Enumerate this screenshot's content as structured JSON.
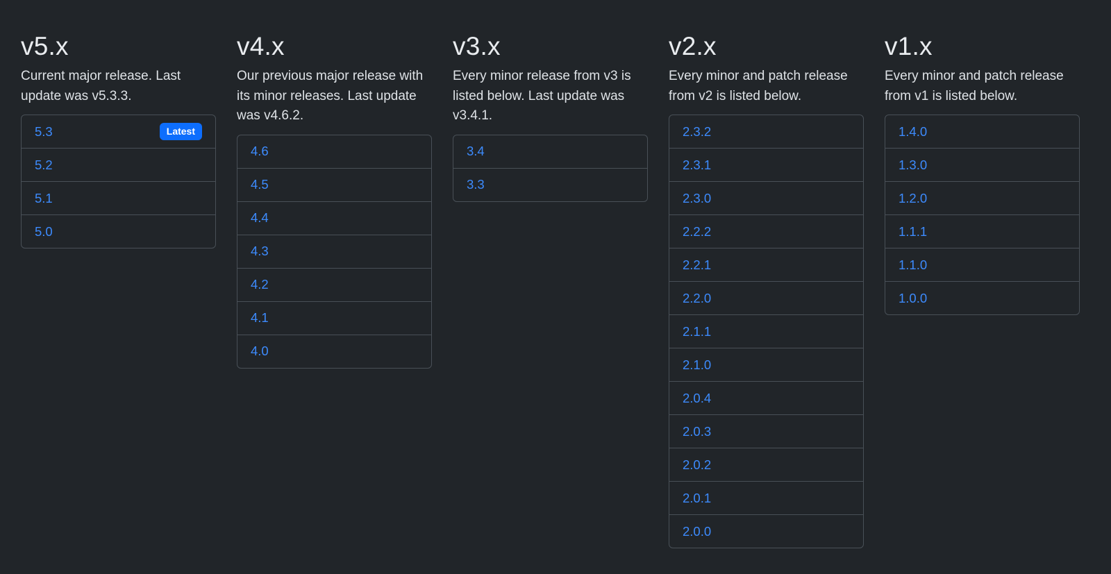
{
  "columns": [
    {
      "title": "v5.x",
      "description": "Current major release. Last update was v5.3.3.",
      "items": [
        {
          "label": "5.3",
          "badge": "Latest"
        },
        {
          "label": "5.2"
        },
        {
          "label": "5.1"
        },
        {
          "label": "5.0"
        }
      ]
    },
    {
      "title": "v4.x",
      "description": "Our previous major release with its minor releases. Last update was v4.6.2.",
      "items": [
        {
          "label": "4.6"
        },
        {
          "label": "4.5"
        },
        {
          "label": "4.4"
        },
        {
          "label": "4.3"
        },
        {
          "label": "4.2"
        },
        {
          "label": "4.1"
        },
        {
          "label": "4.0"
        }
      ]
    },
    {
      "title": "v3.x",
      "description": "Every minor release from v3 is listed below. Last update was v3.4.1.",
      "items": [
        {
          "label": "3.4"
        },
        {
          "label": "3.3"
        }
      ]
    },
    {
      "title": "v2.x",
      "description": "Every minor and patch release from v2 is listed below.",
      "items": [
        {
          "label": "2.3.2"
        },
        {
          "label": "2.3.1"
        },
        {
          "label": "2.3.0"
        },
        {
          "label": "2.2.2"
        },
        {
          "label": "2.2.1"
        },
        {
          "label": "2.2.0"
        },
        {
          "label": "2.1.1"
        },
        {
          "label": "2.1.0"
        },
        {
          "label": "2.0.4"
        },
        {
          "label": "2.0.3"
        },
        {
          "label": "2.0.2"
        },
        {
          "label": "2.0.1"
        },
        {
          "label": "2.0.0"
        }
      ]
    },
    {
      "title": "v1.x",
      "description": "Every minor and patch release from v1 is listed below.",
      "items": [
        {
          "label": "1.4.0"
        },
        {
          "label": "1.3.0"
        },
        {
          "label": "1.2.0"
        },
        {
          "label": "1.1.1"
        },
        {
          "label": "1.1.0"
        },
        {
          "label": "1.0.0"
        }
      ]
    }
  ],
  "colors": {
    "background": "#212529",
    "link": "#3d8bfd",
    "badge": "#0d6efd",
    "border": "#495057"
  }
}
